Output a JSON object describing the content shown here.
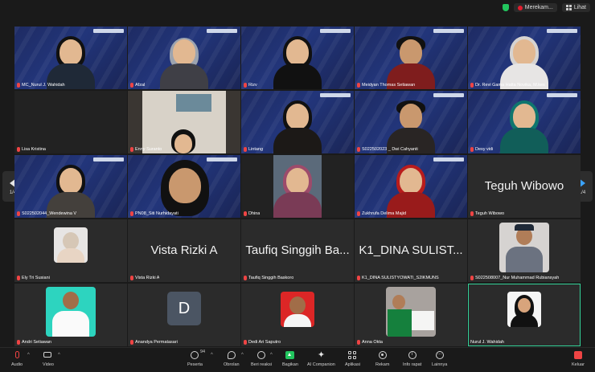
{
  "topbar": {
    "recording_label": "Merekam...",
    "view_label": "Lihat"
  },
  "page_nav": {
    "left_label": "1/4",
    "right_label": "1/4"
  },
  "tiles": [
    "MC_Nurul J. Wahidah",
    "Afzal",
    "Rizv",
    "Meidyan Thomas Setiawan",
    "Dr. Revi Gama Hatta Novika, M.kes",
    "Lisa Kristina",
    "Enny Suranto",
    "Lintang",
    "S022502023 _ Dwi Cahyanti",
    "Desy vidi",
    "S022502044_Wendewina V",
    "PN08_Siti Nurhidayati",
    "Dhina",
    "Zukhrufa Delima Majid",
    "Teguh Wibowo",
    "Ely Tri Susiani",
    "Vista Rizki A",
    "Taufiq Singgih Baskoro",
    "K1_DINA SULISTYOWATI_S2IKMUNS",
    "S022508007_Nur Muhammad Rubiansyah",
    "Andri Setiawan",
    "Anandya Permatasari",
    "Dedi Ari Saputro",
    "Anna Okta",
    "Nurul J. Wahidah"
  ],
  "big_names": {
    "teguh": "Teguh Wibowo",
    "vista": "Vista Rizki A",
    "taufiq": "Taufiq Singgih Ba...",
    "dina": "K1_DINA SULIST..."
  },
  "avatar_letter": "D",
  "participants_count": "94",
  "toolbar": {
    "audio": "Audio",
    "video": "Video",
    "participants": "Peserta",
    "chat": "Obrolan",
    "reactions": "Beri reaksi",
    "share": "Bagikan",
    "ai": "AI Companion",
    "apps": "Aplikasi",
    "record": "Rekam",
    "info": "Info rapat",
    "more": "Lainnya",
    "leave": "Keluar"
  },
  "colors": {
    "accent_green": "#34d399",
    "mute_red": "#ef4444",
    "tile_blue": "#22357a"
  }
}
